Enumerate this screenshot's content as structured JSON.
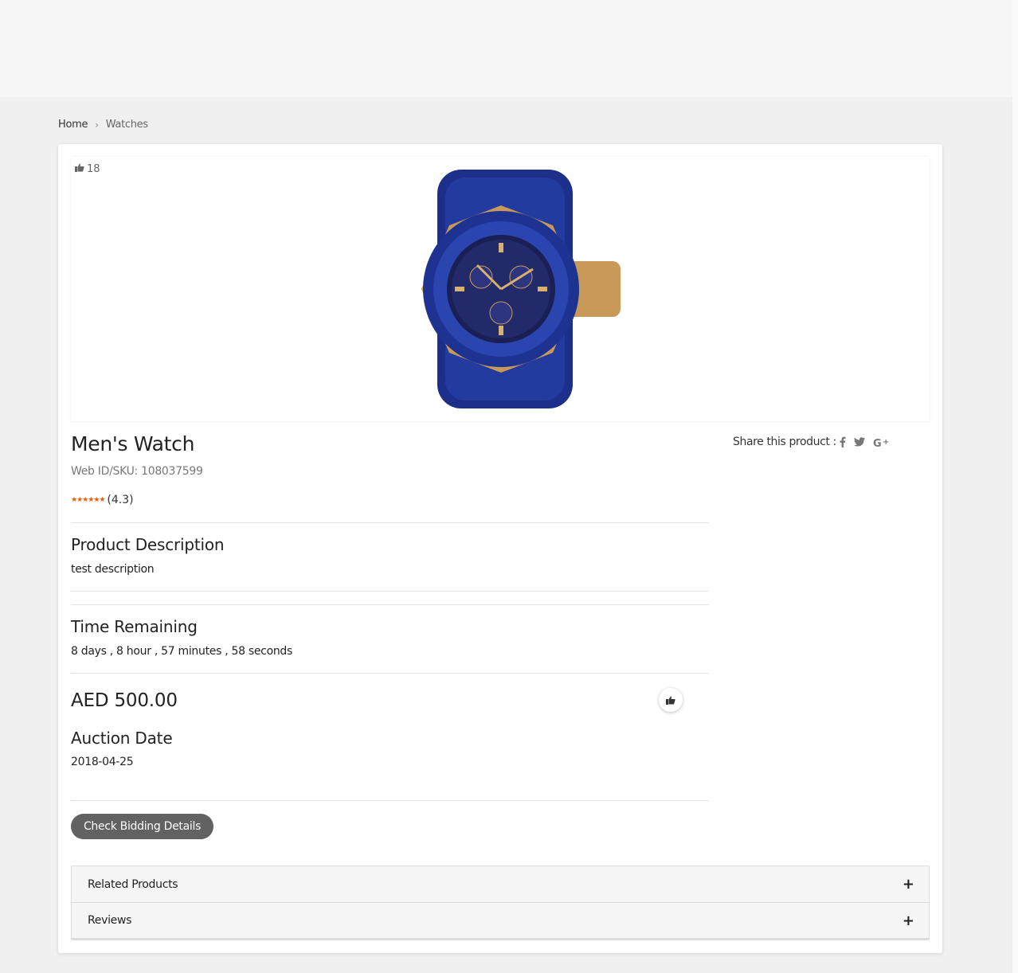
{
  "breadcrumb": {
    "home": "Home",
    "separator": "›",
    "current": "Watches"
  },
  "product": {
    "likes": "18",
    "title": "Men's Watch",
    "sku": "Web ID/SKU: 108037599",
    "rating_stars": "★★★★★★",
    "rating_value": "(4.3)",
    "share_label": "Share this product :",
    "share_icons": [
      "facebook-icon",
      "twitter-icon",
      "google-plus-icon"
    ],
    "description_title": "Product Description",
    "description": "test description",
    "time_title": "Time Remaining",
    "time_remaining": "8 days , 8 hour , 57 minutes , 58 seconds",
    "price": "AED 500.00",
    "auction_title": "Auction Date",
    "auction_date": "2018-04-25",
    "bid_button": "Check Bidding Details"
  },
  "accordion": {
    "items": [
      {
        "label": "Related Products",
        "icon": "+"
      },
      {
        "label": "Reviews",
        "icon": "+"
      }
    ]
  },
  "colors": {
    "star": "#f25c05",
    "button": "#626262",
    "watch_band": "#1c2f8a",
    "watch_gold": "#c9995a"
  }
}
